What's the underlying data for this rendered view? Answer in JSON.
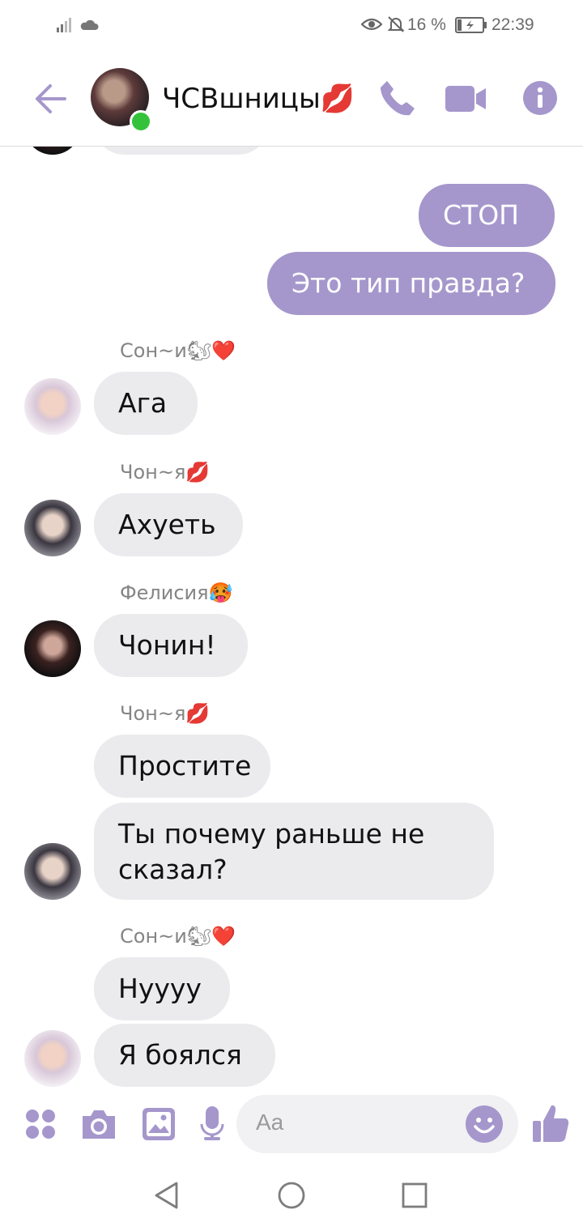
{
  "status_bar": {
    "battery": "16 %",
    "time": "22:39"
  },
  "header": {
    "title": "ЧСВшницы💋"
  },
  "messages": [
    {
      "text": "СТОП",
      "dir": "out"
    },
    {
      "text": "Это тип правда?",
      "dir": "out"
    },
    {
      "sender": "Сон~и🐿❤️",
      "text": "Ага"
    },
    {
      "sender": "Чон~я💋",
      "text": "Ахуеть"
    },
    {
      "sender": "Фелисия🥵",
      "text": "Чонин!"
    },
    {
      "sender": "Чон~я💋",
      "text": "Простите"
    },
    {
      "text_line1": "Ты почему раньше не",
      "text_line2": "сказал?"
    },
    {
      "sender": "Сон~и🐿❤️",
      "text": "Нуууу"
    },
    {
      "text": "Я боялся"
    }
  ],
  "composer": {
    "placeholder": "Aa"
  },
  "icons": {
    "accent": "#a597cc",
    "online": "#34c23a"
  }
}
